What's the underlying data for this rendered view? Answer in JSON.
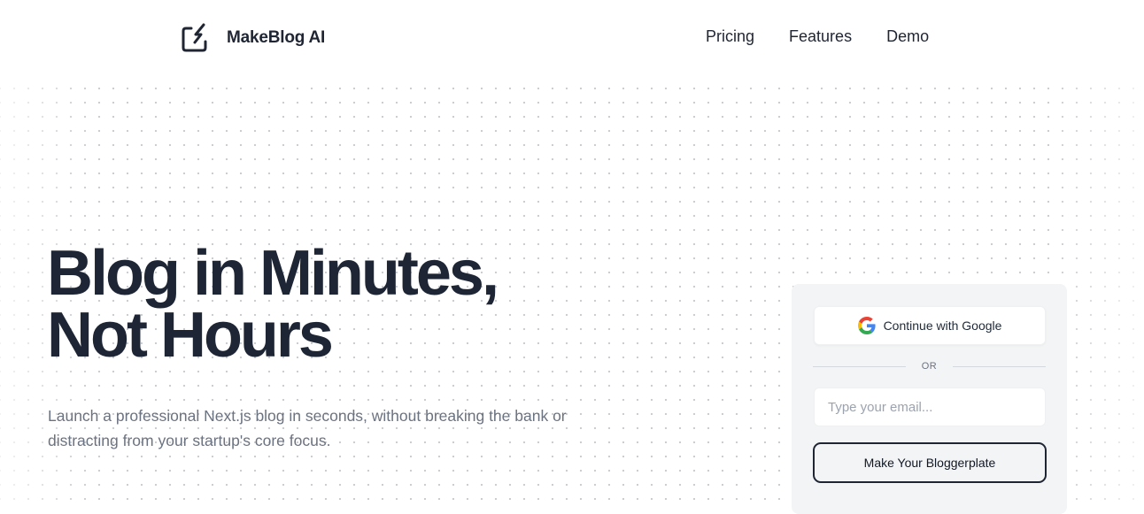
{
  "header": {
    "brand": "MakeBlog AI",
    "nav": [
      "Pricing",
      "Features",
      "Demo"
    ]
  },
  "hero": {
    "title_line1": "Blog in Minutes,",
    "title_line2": "Not Hours",
    "subtitle": "Launch a professional Next.js blog in seconds, without breaking the bank or distracting from your startup's core focus."
  },
  "signup": {
    "google_label": "Continue with Google",
    "divider": "OR",
    "email_placeholder": "Type your email...",
    "cta_label": "Make Your Bloggerplate"
  },
  "icons": {
    "logo": "bolt-window-icon",
    "google": "google-g-icon"
  },
  "colors": {
    "text_dark": "#1e2635",
    "muted": "#6b7280",
    "card_bg": "#f3f4f5",
    "google_blue": "#4285F4",
    "google_red": "#EA4335",
    "google_yellow": "#FBBC05",
    "google_green": "#34A853"
  }
}
